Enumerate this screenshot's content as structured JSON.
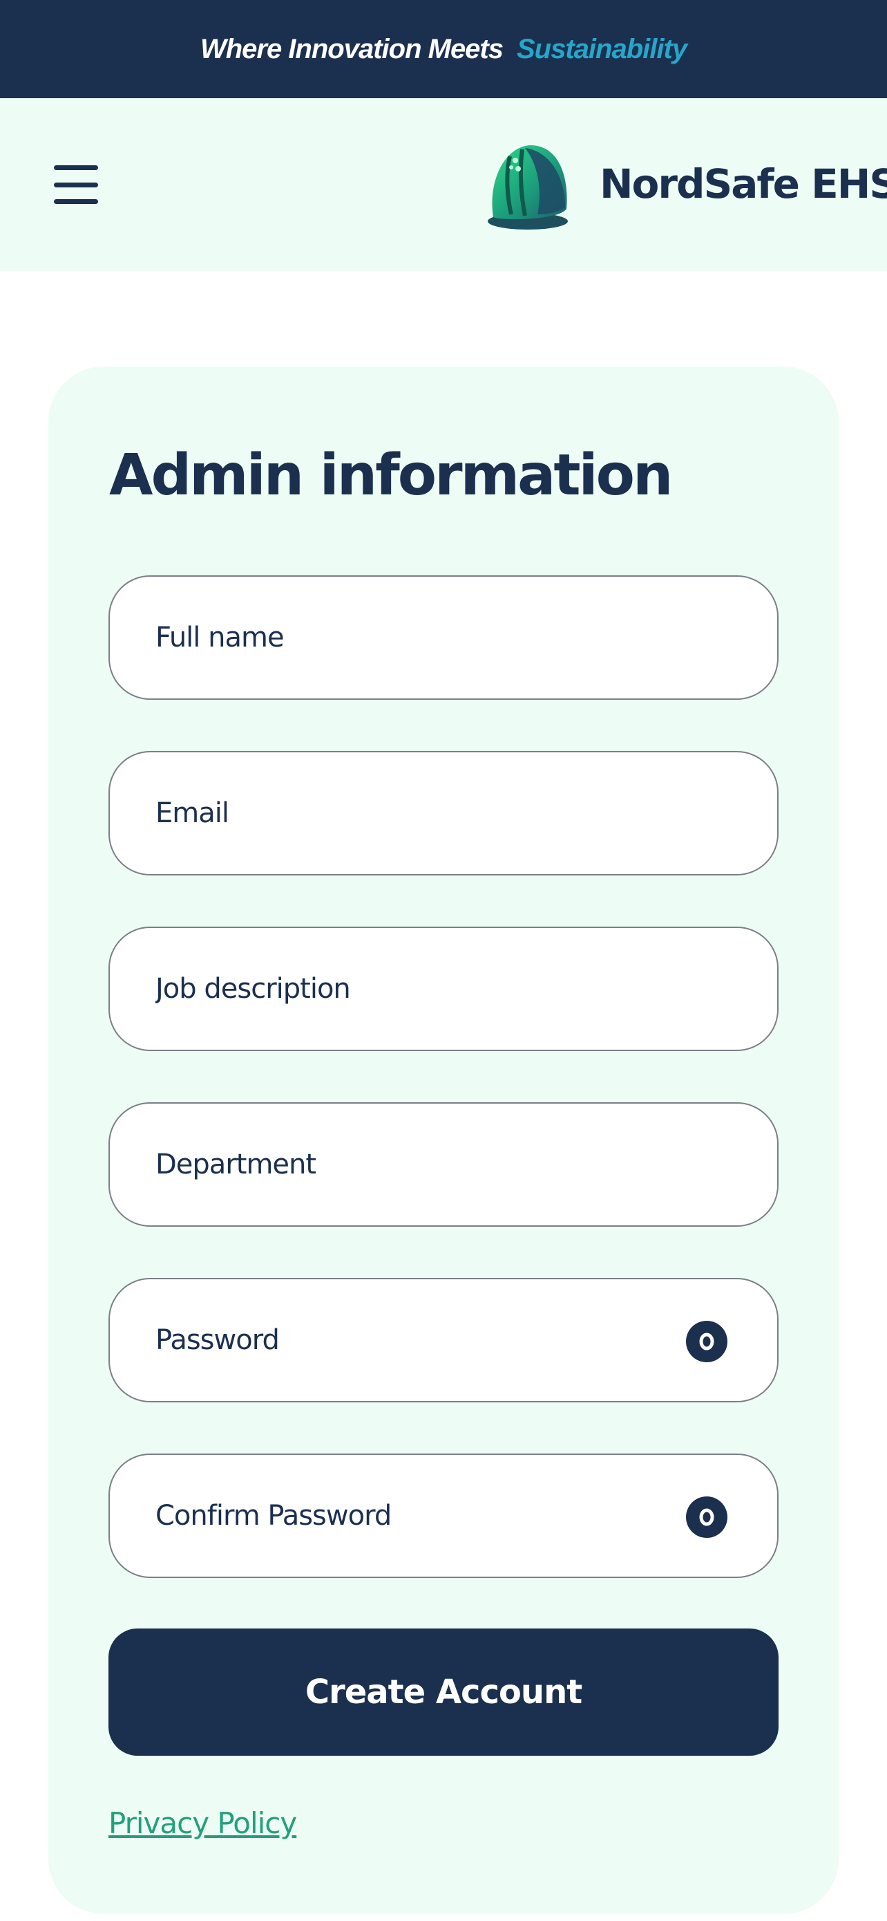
{
  "banner": {
    "text_main": "Where Innovation Meets",
    "text_accent": "Sustainability"
  },
  "header": {
    "menu_icon": "hamburger-menu-icon",
    "logo_icon": "hard-hat-icon",
    "brand_name": "NordSafe EHS"
  },
  "form": {
    "title": "Admin information",
    "fields": [
      {
        "placeholder": "Full name",
        "value": ""
      },
      {
        "placeholder": "Email",
        "value": ""
      },
      {
        "placeholder": "Job description",
        "value": ""
      },
      {
        "placeholder": "Department",
        "value": ""
      },
      {
        "placeholder": "Password",
        "value": "",
        "icon": "eye-icon"
      },
      {
        "placeholder": "Confirm Password",
        "value": "",
        "icon": "eye-icon"
      }
    ],
    "submit_label": "Create Account",
    "privacy_link": "Privacy Policy"
  },
  "colors": {
    "navy": "#1b2f4f",
    "accent_blue": "#27a6c9",
    "mint_background": "#edfdf5",
    "link_green": "#23a07a"
  }
}
